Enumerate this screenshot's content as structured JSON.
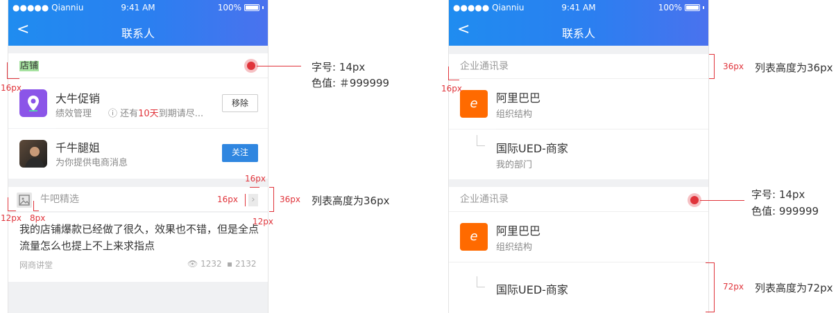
{
  "status": {
    "carrier": "●●●●● Qianniu",
    "time": "9:41 AM",
    "battery": "100%"
  },
  "nav": {
    "title": "联系人",
    "back_glyph": "<"
  },
  "left": {
    "shop_label": "店铺",
    "contacts": [
      {
        "name": "大牛促销",
        "sub1": "绩效管理",
        "info_pre": "ⓘ 还有",
        "info_hl": "10天",
        "info_post": "到期请尽...",
        "button": "移除"
      },
      {
        "name": "千牛腿姐",
        "sub1": "为你提供电商消息",
        "button": "关注"
      }
    ],
    "feed_header": "牛吧精选",
    "post_text": "我的店铺爆款已经做了很久，效果也不错，但是全点流量怎么也提上不上来求指点",
    "post_source": "网商讲堂",
    "views": "1232",
    "comments": "2132"
  },
  "right": {
    "section1": "企业通讯录",
    "org1": {
      "name": "阿里巴巴",
      "sub": "组织结构"
    },
    "dept1": {
      "name": "国际UED-商家",
      "sub": "我的部门"
    },
    "section2": "企业通讯录",
    "org2": {
      "name": "阿里巴巴",
      "sub": "组织结构"
    },
    "dept2": {
      "name": "国际UED-商家"
    }
  },
  "annotations": {
    "left_font_label": "字号: 14px",
    "left_color_label": "色值: ＃999999",
    "l_16px": "16px",
    "l_12px": "12px",
    "l_8px": "8px",
    "l_16px_a": "16px",
    "l_16px_b": "16px",
    "l_36px": "36px",
    "l_12px_b": "12px",
    "l_list36": "列表高度为36px",
    "r_36px": "36px",
    "r_list36": "列表高度为36px",
    "r_16px": "16px",
    "r_font_label": "字号: 14px",
    "r_color_label": "色值: 999999",
    "r_72px": "72px",
    "r_list72": "列表高度为72px"
  },
  "colors": {
    "header_start": "#1f8cf0",
    "header_end": "#4a72ee",
    "accent": "#2f86e0",
    "annotation": "#e0333a",
    "highlight": "#10a0ff",
    "logo": "#ff6a00"
  }
}
